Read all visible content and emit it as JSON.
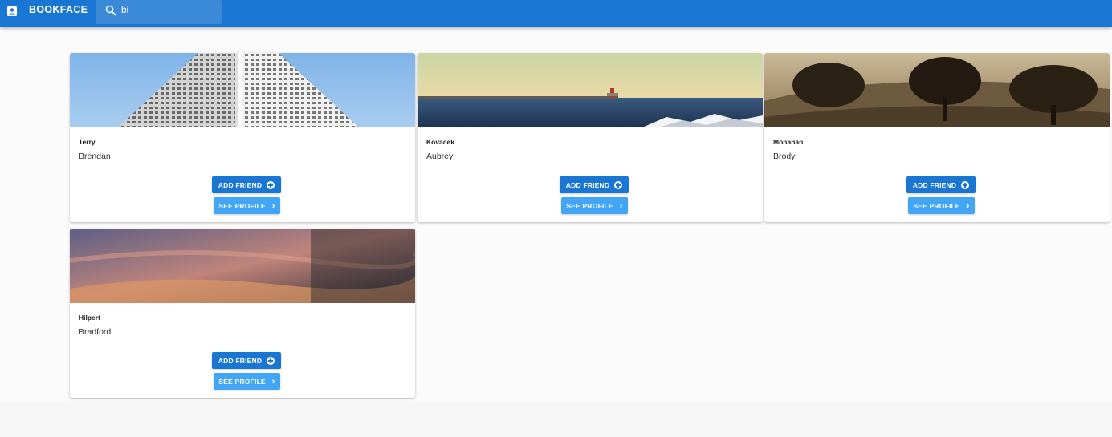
{
  "app": {
    "brand": "BOOKFACE",
    "icon": "contact-icon"
  },
  "search": {
    "value": "bi",
    "icon": "search-icon"
  },
  "colors": {
    "primary": "#1976d2",
    "secondary": "#42a5f5"
  },
  "cards": [
    {
      "last_name": "Terry",
      "first_name": "Brendan",
      "add_label": "ADD FRIEND",
      "see_label": "SEE PROFILE"
    },
    {
      "last_name": "Kovacek",
      "first_name": "Aubrey",
      "add_label": "ADD FRIEND",
      "see_label": "SEE PROFILE"
    },
    {
      "last_name": "Monahan",
      "first_name": "Brody",
      "add_label": "ADD FRIEND",
      "see_label": "SEE PROFILE"
    },
    {
      "last_name": "Hilpert",
      "first_name": "Bradford",
      "add_label": "ADD FRIEND",
      "see_label": "SEE PROFILE"
    }
  ]
}
